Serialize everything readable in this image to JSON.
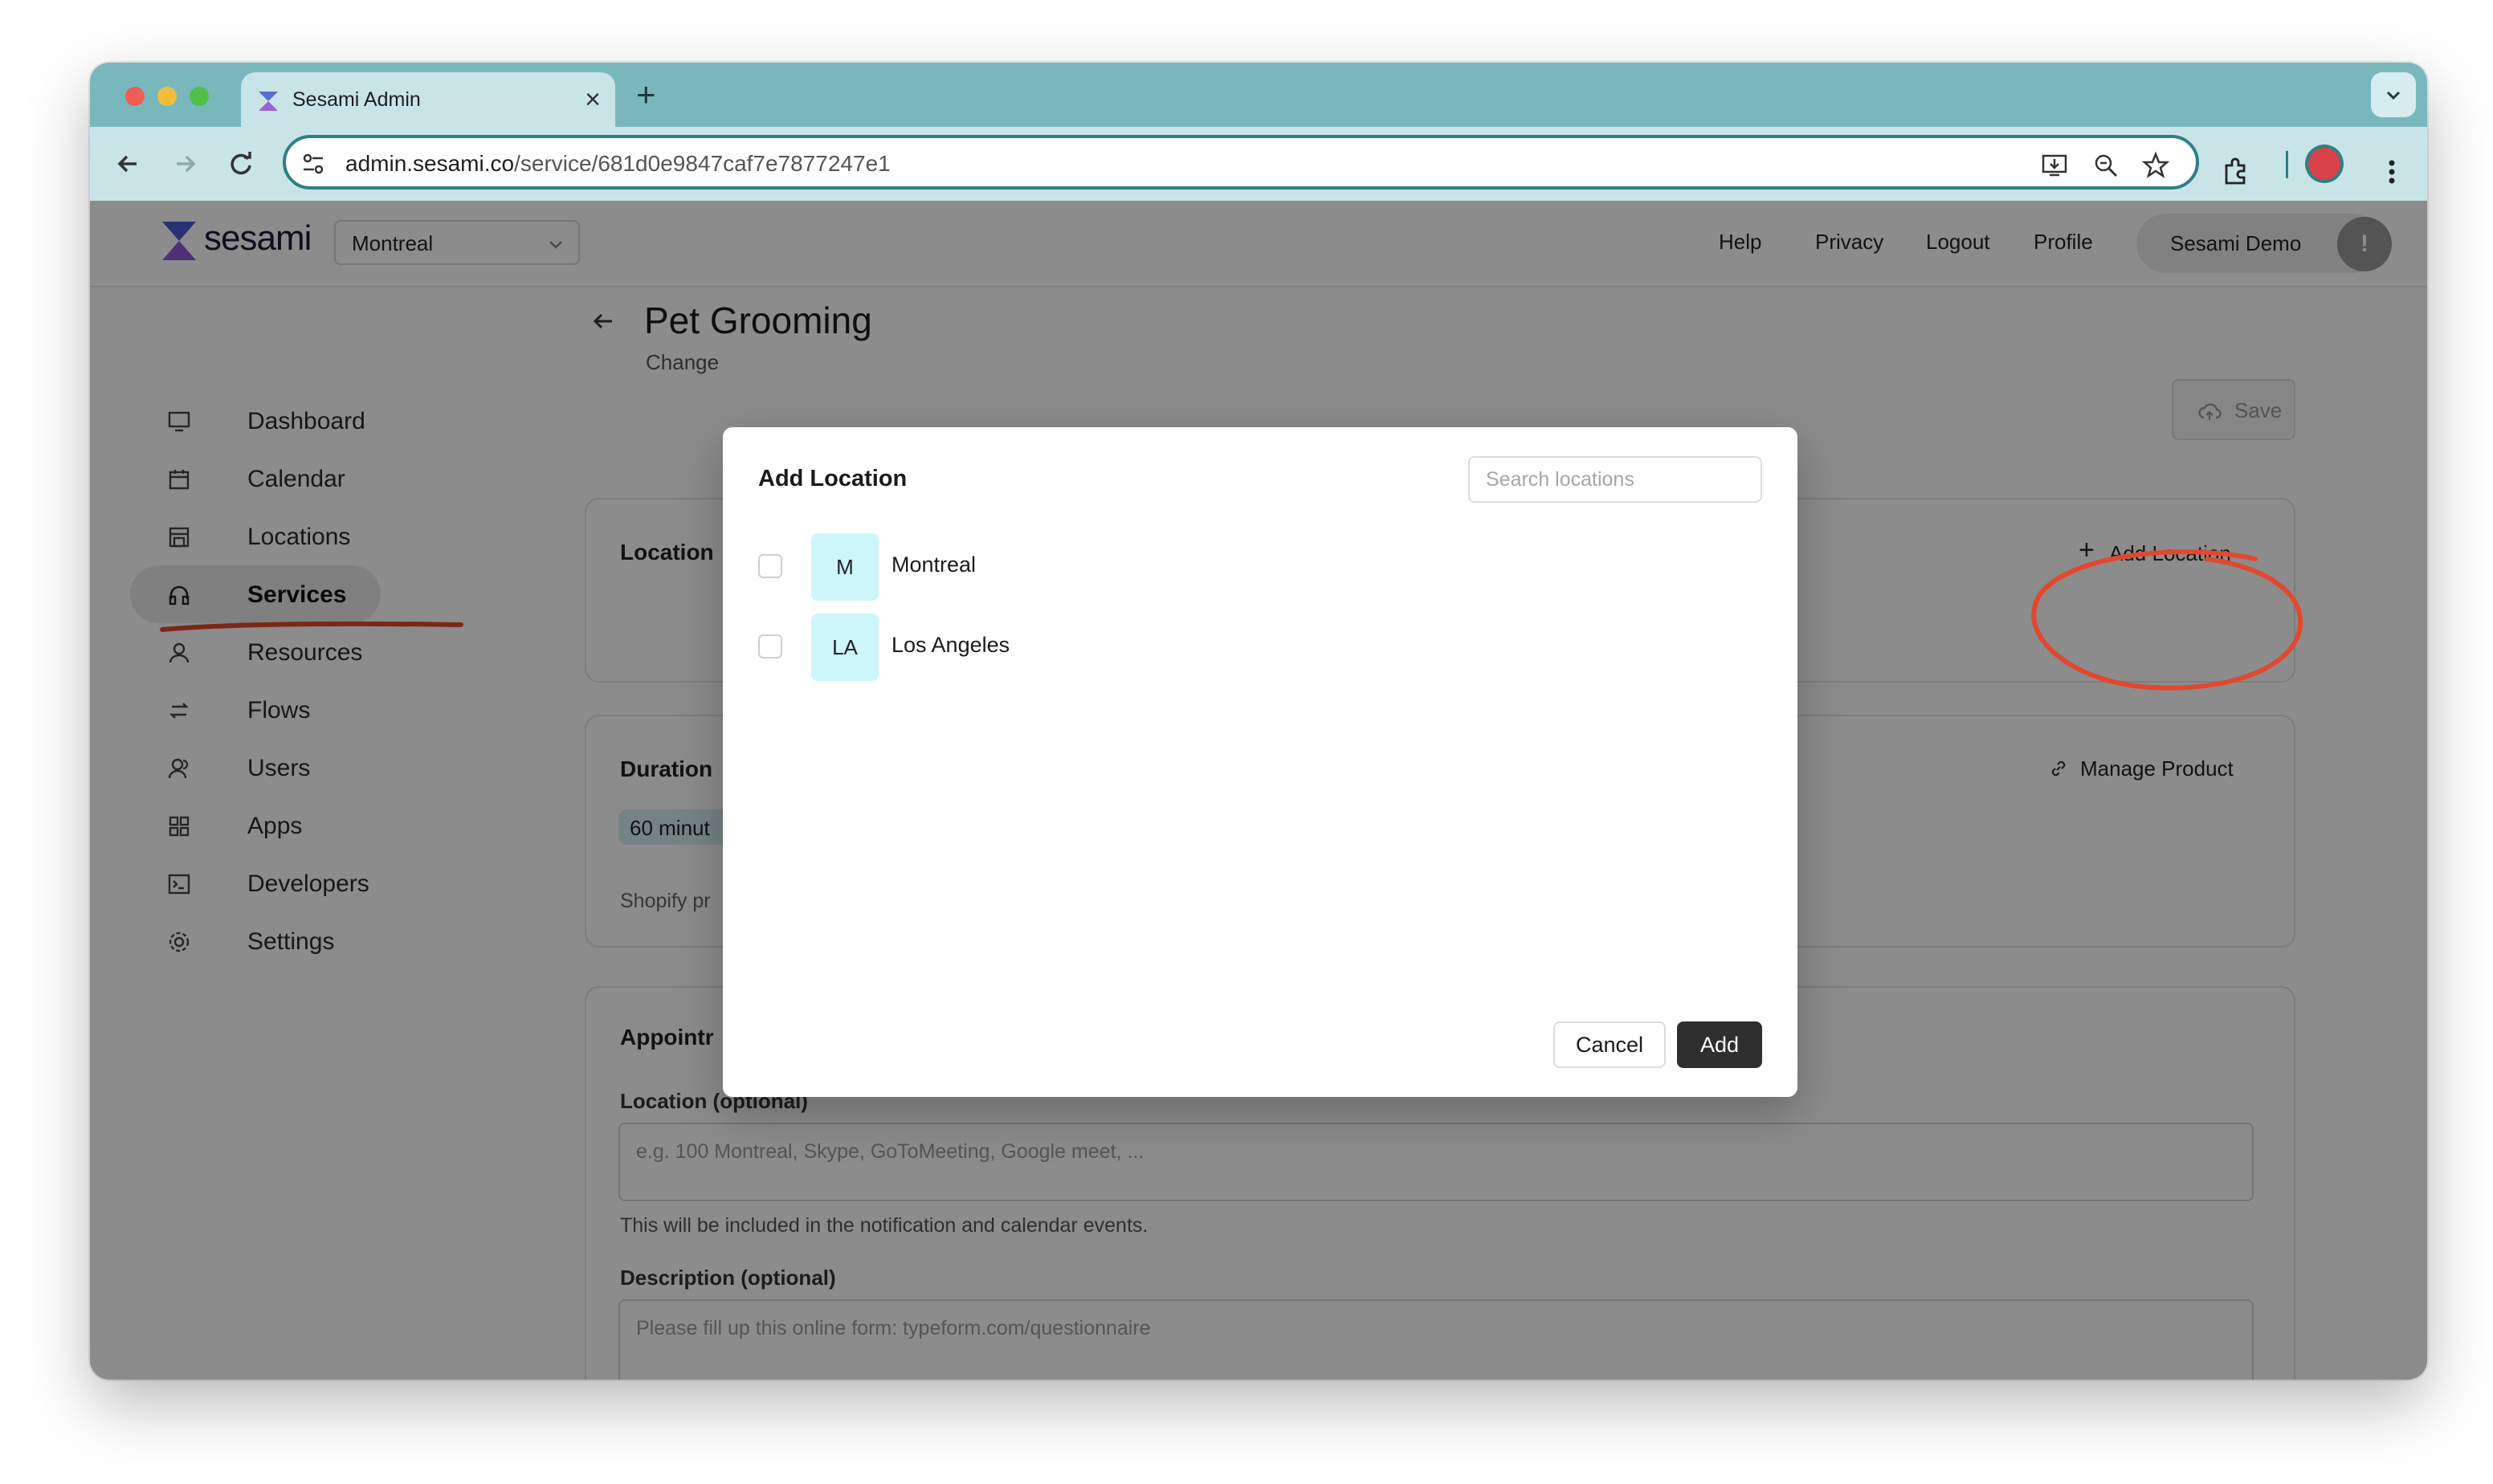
{
  "browser": {
    "tab_title": "Sesami Admin",
    "url_domain": "admin.sesami.co",
    "url_path": "/service/681d0e9847caf7e7877247e1"
  },
  "header": {
    "logo_text": "sesami",
    "location_select": "Montreal",
    "links": [
      "Help",
      "Privacy",
      "Logout",
      "Profile"
    ],
    "user_name": "Sesami Demo",
    "avatar_initial": "!"
  },
  "sidebar": {
    "items": [
      {
        "label": "Dashboard",
        "icon": "monitor-icon"
      },
      {
        "label": "Calendar",
        "icon": "calendar-icon"
      },
      {
        "label": "Locations",
        "icon": "store-icon"
      },
      {
        "label": "Services",
        "icon": "headset-icon",
        "active": true
      },
      {
        "label": "Resources",
        "icon": "person-icon"
      },
      {
        "label": "Flows",
        "icon": "flow-icon"
      },
      {
        "label": "Users",
        "icon": "users-icon"
      },
      {
        "label": "Apps",
        "icon": "apps-icon"
      },
      {
        "label": "Developers",
        "icon": "terminal-icon"
      },
      {
        "label": "Settings",
        "icon": "gear-icon"
      }
    ]
  },
  "page": {
    "title": "Pet Grooming",
    "subtitle": "Change",
    "save_label": "Save"
  },
  "cards": {
    "locations": {
      "title": "Location",
      "add_label": "Add Location"
    },
    "duration": {
      "title": "Duration",
      "chip": "60 minut",
      "note": "Shopify pr",
      "link_label": "Manage Product"
    },
    "appointment": {
      "title": "Appointr",
      "location_label": "Location (optional)",
      "location_placeholder": "e.g. 100 Montreal, Skype, GoToMeeting, Google meet, ...",
      "location_help": "This will be included in the notification and calendar events.",
      "description_label": "Description (optional)",
      "description_placeholder": "Please fill up this online form: typeform.com/questionnaire"
    }
  },
  "modal": {
    "title": "Add Location",
    "search_placeholder": "Search locations",
    "locations": [
      {
        "initials": "M",
        "name": "Montreal",
        "checked": false
      },
      {
        "initials": "LA",
        "name": "Los Angeles",
        "checked": false
      }
    ],
    "cancel_label": "Cancel",
    "add_label": "Add"
  },
  "colors": {
    "tab_bar": "#78b8bd",
    "toolbar": "#c9e4e6",
    "accent": "#2f7f86",
    "badge": "#cdf6f7",
    "annotation": "#e0492f",
    "primary_button": "#2e2e2e"
  }
}
